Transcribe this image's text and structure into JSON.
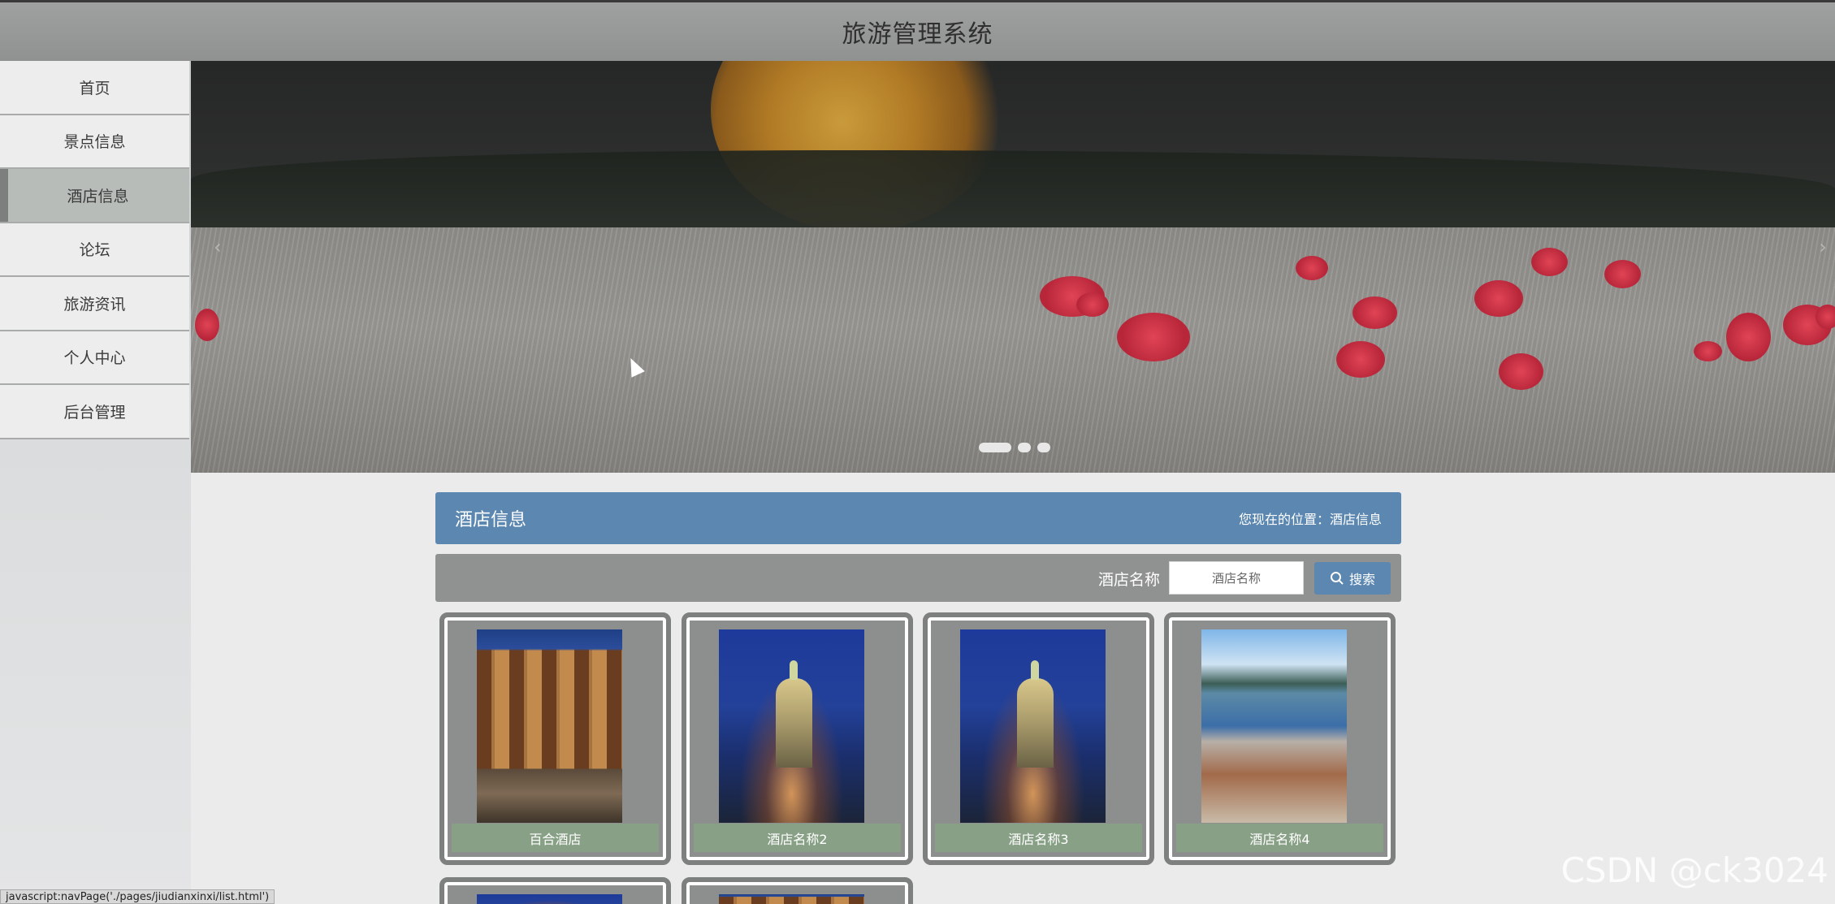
{
  "header": {
    "title": "旅游管理系统"
  },
  "sidebar": {
    "items": [
      {
        "label": "首页"
      },
      {
        "label": "景点信息"
      },
      {
        "label": "酒店信息",
        "active": true
      },
      {
        "label": "论坛"
      },
      {
        "label": "旅游资讯"
      },
      {
        "label": "个人中心"
      },
      {
        "label": "后台管理"
      }
    ]
  },
  "banner": {
    "slide_count": 3,
    "active_slide": 1,
    "prev_icon": "chevron-left-icon",
    "next_icon": "chevron-right-icon"
  },
  "content": {
    "title": "酒店信息",
    "breadcrumb": "您现在的位置：酒店信息"
  },
  "search": {
    "label": "酒店名称",
    "placeholder": "酒店名称",
    "button_label": "搜索",
    "button_icon": "search-icon"
  },
  "hotels": [
    {
      "name": "百合酒店"
    },
    {
      "name": "酒店名称2"
    },
    {
      "name": "酒店名称3"
    },
    {
      "name": "酒店名称4"
    }
  ],
  "status_bar": {
    "text": "javascript:navPage('./pages/jiudianxinxi/list.html')"
  },
  "watermark": "CSDN @ck3024",
  "colors": {
    "primary": "#5b87b1",
    "card_label": "#88a186",
    "header": "#9ea19f"
  }
}
